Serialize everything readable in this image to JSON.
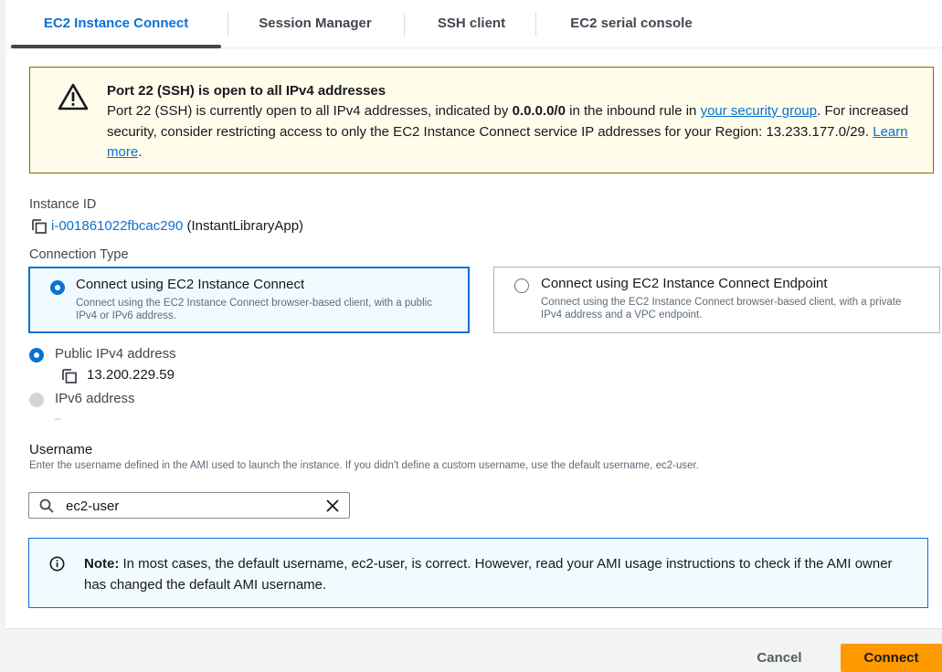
{
  "tabs": [
    {
      "label": "EC2 Instance Connect",
      "active": true
    },
    {
      "label": "Session Manager"
    },
    {
      "label": "SSH client"
    },
    {
      "label": "EC2 serial console"
    }
  ],
  "warning": {
    "title": "Port 22 (SSH) is open to all IPv4 addresses",
    "text1": "Port 22 (SSH) is currently open to all IPv4 addresses, indicated by ",
    "bold": "0.0.0.0/0",
    "text2": " in the inbound rule in ",
    "link1": "your security group",
    "text3": ". For increased security, consider restricting access to only the EC2 Instance Connect service IP addresses for your Region: 13.233.177.0/29. ",
    "link2": "Learn more",
    "text4": "."
  },
  "instance": {
    "label": "Instance ID",
    "id": "i-001861022fbcac290",
    "name": "(InstantLibraryApp)"
  },
  "connection": {
    "label": "Connection Type",
    "options": [
      {
        "title": "Connect using EC2 Instance Connect",
        "desc": "Connect using the EC2 Instance Connect browser-based client, with a public IPv4 or IPv6 address.",
        "selected": true
      },
      {
        "title": "Connect using EC2 Instance Connect Endpoint",
        "desc": "Connect using the EC2 Instance Connect browser-based client, with a private IPv4 address and a VPC endpoint.",
        "selected": false
      }
    ]
  },
  "address": {
    "public_label": "Public IPv4 address",
    "public_value": "13.200.229.59",
    "ipv6_label": "IPv6 address",
    "ipv6_value": "–"
  },
  "username": {
    "label": "Username",
    "desc": "Enter the username defined in the AMI used to launch the instance. If you didn't define a custom username, use the default username, ec2-user.",
    "value": "ec2-user"
  },
  "note": {
    "bold": "Note:",
    "text": " In most cases, the default username, ec2-user, is correct. However, read your AMI usage instructions to check if the AMI owner has changed the default AMI username."
  },
  "footer": {
    "cancel": "Cancel",
    "connect": "Connect"
  },
  "colors": {
    "accent": "#0972d3",
    "warning_bg": "#fffce9",
    "primary_button": "#ff9900"
  }
}
